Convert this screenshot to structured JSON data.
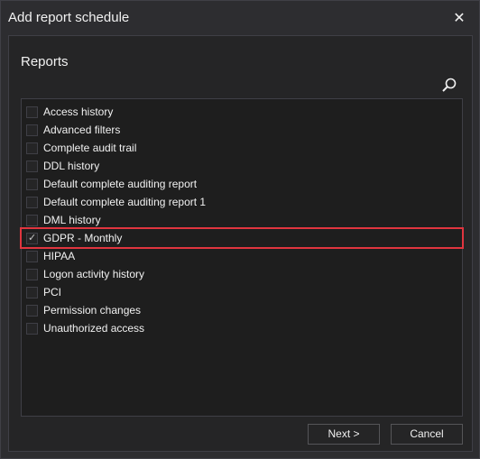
{
  "window": {
    "title": "Add report schedule",
    "close_glyph": "✕"
  },
  "main": {
    "section_title": "Reports",
    "search_icon": "search-icon",
    "reports": [
      {
        "label": "Access history",
        "checked": false
      },
      {
        "label": "Advanced filters",
        "checked": false
      },
      {
        "label": "Complete audit trail",
        "checked": false
      },
      {
        "label": "DDL history",
        "checked": false
      },
      {
        "label": "Default complete auditing report",
        "checked": false
      },
      {
        "label": "Default complete auditing report 1",
        "checked": false
      },
      {
        "label": "DML history",
        "checked": false
      },
      {
        "label": "GDPR - Monthly",
        "checked": true,
        "highlighted": true
      },
      {
        "label": "HIPAA",
        "checked": false
      },
      {
        "label": "Logon activity history",
        "checked": false
      },
      {
        "label": "PCI",
        "checked": false
      },
      {
        "label": "Permission changes",
        "checked": false
      },
      {
        "label": "Unauthorized access",
        "checked": false
      }
    ],
    "check_glyph": "✓"
  },
  "footer": {
    "next_label": "Next >",
    "cancel_label": "Cancel"
  },
  "colors": {
    "highlight_border": "#e0353f",
    "background": "#2d2d30",
    "list_background": "#1e1e1e"
  }
}
